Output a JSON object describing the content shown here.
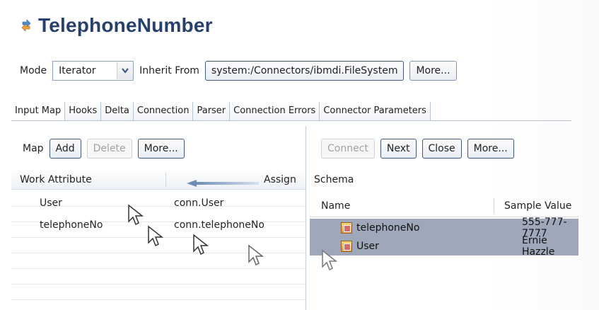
{
  "title": "TelephoneNumber",
  "mode": {
    "label": "Mode",
    "value": "Iterator",
    "inherit_label": "Inherit From",
    "inherit_value": "system:/Connectors/ibmdi.FileSystem",
    "more_label": "More..."
  },
  "tabs": [
    "Input Map",
    "Hooks",
    "Delta",
    "Connection",
    "Parser",
    "Connection Errors",
    "Connector Parameters"
  ],
  "left": {
    "map_label": "Map",
    "buttons": {
      "add": "Add",
      "delete": "Delete",
      "more": "More..."
    },
    "columns": {
      "work_attribute": "Work Attribute",
      "assign": "Assign"
    },
    "rows": [
      {
        "work_attribute": "User",
        "assign": "conn.User"
      },
      {
        "work_attribute": "telephoneNo",
        "assign": "conn.telephoneNo"
      }
    ]
  },
  "right": {
    "buttons": {
      "connect": "Connect",
      "next": "Next",
      "close": "Close",
      "more": "More..."
    },
    "schema_label": "Schema",
    "columns": {
      "name": "Name",
      "sample_value": "Sample Value"
    },
    "rows": [
      {
        "name": "telephoneNo",
        "sample_value": "555-777-7777"
      },
      {
        "name": "User",
        "sample_value": "Ernie Hazzle"
      }
    ]
  },
  "icons": {
    "title_icon": "connector-icon",
    "dropdown": "chevron-down-icon",
    "attribute": "attribute-icon",
    "assign_arrow": "arrow-left-icon",
    "cursor": "mouse-cursor-icon"
  },
  "colors": {
    "title": "#29406b",
    "selection": "#9ea8ba",
    "border": "#7d93b2"
  }
}
